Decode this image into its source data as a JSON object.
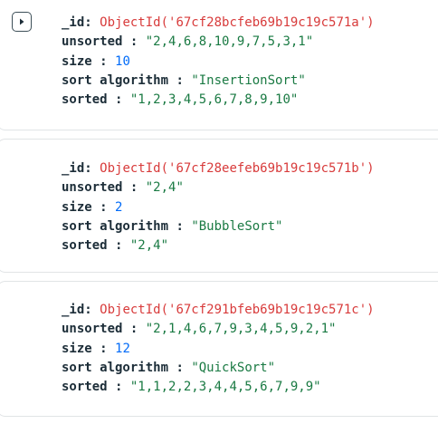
{
  "documents": [
    {
      "expandable": true,
      "fields": [
        {
          "key": "_id",
          "value": "ObjectId('67cf28bcfeb69b19c19c571a')",
          "type": "oid"
        },
        {
          "key": "unsorted",
          "value": "\"2,4,6,8,10,9,7,5,3,1\"",
          "type": "str"
        },
        {
          "key": "size",
          "value": "10",
          "type": "num"
        },
        {
          "key": "sort algorithm",
          "value": "\"InsertionSort\"",
          "type": "str"
        },
        {
          "key": "sorted",
          "value": "\"1,2,3,4,5,6,7,8,9,10\"",
          "type": "str"
        }
      ]
    },
    {
      "expandable": false,
      "fields": [
        {
          "key": "_id",
          "value": "ObjectId('67cf28eefeb69b19c19c571b')",
          "type": "oid"
        },
        {
          "key": "unsorted",
          "value": "\"2,4\"",
          "type": "str"
        },
        {
          "key": "size",
          "value": "2",
          "type": "num"
        },
        {
          "key": "sort algorithm",
          "value": "\"BubbleSort\"",
          "type": "str"
        },
        {
          "key": "sorted",
          "value": "\"2,4\"",
          "type": "str"
        }
      ]
    },
    {
      "expandable": false,
      "fields": [
        {
          "key": "_id",
          "value": "ObjectId('67cf291bfeb69b19c19c571c')",
          "type": "oid"
        },
        {
          "key": "unsorted",
          "value": "\"2,1,4,6,7,9,3,4,5,9,2,1\"",
          "type": "str"
        },
        {
          "key": "size",
          "value": "12",
          "type": "num"
        },
        {
          "key": "sort algorithm",
          "value": "\"QuickSort\"",
          "type": "str"
        },
        {
          "key": "sorted",
          "value": "\"1,1,2,2,3,4,4,5,6,7,9,9\"",
          "type": "str"
        }
      ]
    }
  ],
  "icons": {
    "expand": "caret-right-icon"
  }
}
